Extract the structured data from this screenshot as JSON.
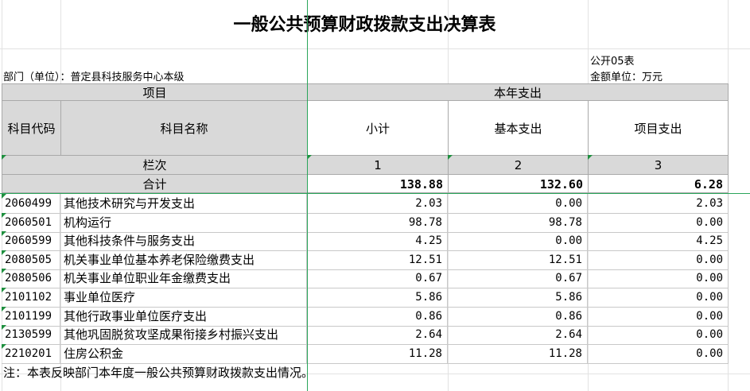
{
  "title": "一般公共预算财政拨款支出决算表",
  "form_code": "公开05表",
  "unit_label": "金额单位：万元",
  "dept_label": "部门（单位）：普定县科技服务中心本级",
  "header": {
    "item": "项目",
    "current_year": "本年支出",
    "code": "科目代码",
    "name": "科目名称",
    "subtotal": "小计",
    "basic": "基本支出",
    "project": "项目支出",
    "col_label": "栏次",
    "col1": "1",
    "col2": "2",
    "col3": "3",
    "total_label": "合计",
    "total_subtotal": "138.88",
    "total_basic": "132.60",
    "total_project": "6.28"
  },
  "rows": [
    {
      "code": "2060499",
      "name": "其他技术研究与开发支出",
      "subtotal": "2.03",
      "basic": "0.00",
      "project": "2.03"
    },
    {
      "code": "2060501",
      "name": "机构运行",
      "subtotal": "98.78",
      "basic": "98.78",
      "project": "0.00"
    },
    {
      "code": "2060599",
      "name": "其他科技条件与服务支出",
      "subtotal": "4.25",
      "basic": "0.00",
      "project": "4.25"
    },
    {
      "code": "2080505",
      "name": "机关事业单位基本养老保险缴费支出",
      "subtotal": "12.51",
      "basic": "12.51",
      "project": "0.00"
    },
    {
      "code": "2080506",
      "name": "机关事业单位职业年金缴费支出",
      "subtotal": "0.67",
      "basic": "0.67",
      "project": "0.00"
    },
    {
      "code": "2101102",
      "name": "事业单位医疗",
      "subtotal": "5.86",
      "basic": "5.86",
      "project": "0.00"
    },
    {
      "code": "2101199",
      "name": "其他行政事业单位医疗支出",
      "subtotal": "0.86",
      "basic": "0.86",
      "project": "0.00"
    },
    {
      "code": "2130599",
      "name": "其他巩固脱贫攻坚成果衔接乡村振兴支出",
      "subtotal": "2.64",
      "basic": "2.64",
      "project": "0.00"
    },
    {
      "code": "2210201",
      "name": "住房公积金",
      "subtotal": "11.28",
      "basic": "11.28",
      "project": "0.00"
    }
  ],
  "note": "注：本表反映部门本年度一般公共预算财政拨款支出情况。",
  "colors": {
    "header_bg": "#d9d9d9",
    "selection": "#2aa55a",
    "comment_marker": "#1e8f3e"
  }
}
